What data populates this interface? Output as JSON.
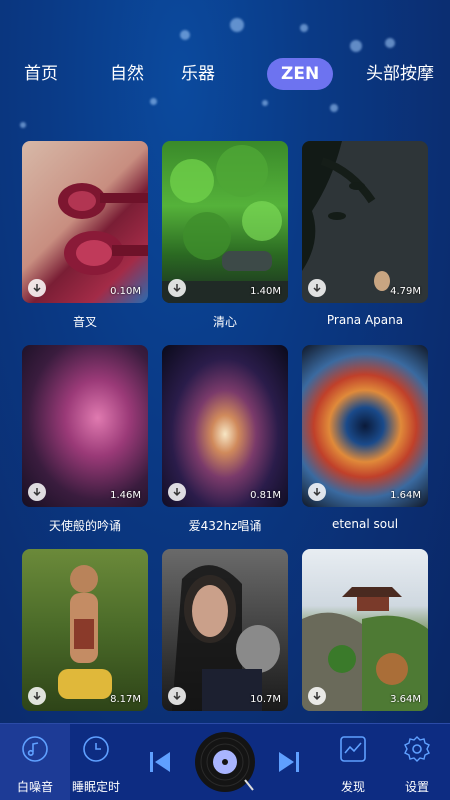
{
  "tabs": [
    {
      "label": "首页"
    },
    {
      "label": "自然"
    },
    {
      "label": "乐器"
    },
    {
      "label": "ZEN",
      "active": true
    },
    {
      "label": "头部按摩"
    }
  ],
  "items": [
    {
      "name": "音叉",
      "size": "0.10M"
    },
    {
      "name": "清心",
      "size": "1.40M"
    },
    {
      "name": "Prana Apana",
      "size": "4.79M"
    },
    {
      "name": "天使般的吟诵",
      "size": "1.46M"
    },
    {
      "name": "爱432hz唱诵",
      "size": "0.81M"
    },
    {
      "name": "etenal soul",
      "size": "1.64M"
    },
    {
      "name": "",
      "size": "8.17M"
    },
    {
      "name": "",
      "size": "10.7M"
    },
    {
      "name": "",
      "size": "3.64M"
    }
  ],
  "bottom_nav": {
    "white_noise": "白噪音",
    "sleep_timer": "睡眠定时",
    "discover": "发现",
    "settings": "设置"
  },
  "colors": {
    "accent": "#6d73f0",
    "nav_bg": "#0d2c82",
    "icon": "#5fa0ff"
  }
}
